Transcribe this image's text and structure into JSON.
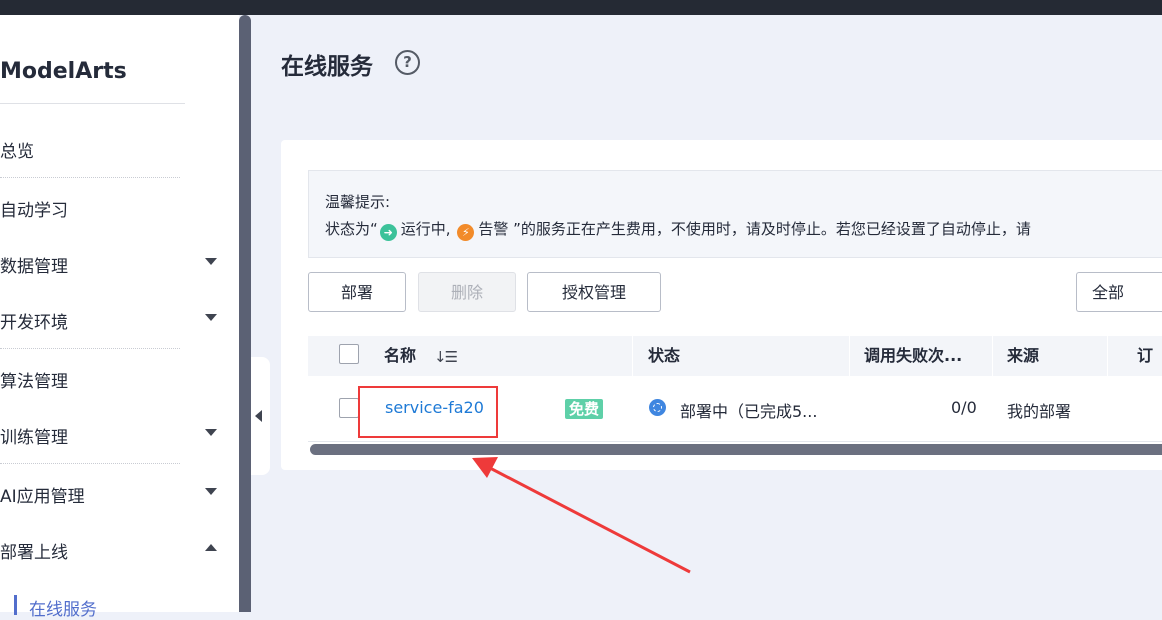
{
  "sidebar": {
    "brand": "ModelArts",
    "items": [
      {
        "label": "总览",
        "expandable": false
      },
      {
        "label": "自动学习",
        "expandable": false
      },
      {
        "label": "数据管理",
        "expandable": true,
        "expanded": false
      },
      {
        "label": "开发环境",
        "expandable": true,
        "expanded": false
      },
      {
        "label": "算法管理",
        "expandable": false
      },
      {
        "label": "训练管理",
        "expandable": true,
        "expanded": false
      },
      {
        "label": "AI应用管理",
        "expandable": true,
        "expanded": false
      },
      {
        "label": "部署上线",
        "expandable": true,
        "expanded": true
      }
    ],
    "sub_items": [
      {
        "label": "在线服务",
        "active": true
      }
    ]
  },
  "header": {
    "title": "在线服务",
    "help_icon": "question-circle-icon"
  },
  "notice": {
    "title": "温馨提示:",
    "prefix": "状态为“",
    "running_label": "运行中,",
    "alarm_label": "告警",
    "suffix": "”的服务正在产生费用，不使用时，请及时停止。若您已经设置了自动停止，请",
    "colors": {
      "running": "#3cc29a",
      "alarm": "#f28b2a"
    }
  },
  "toolbar": {
    "deploy_label": "部署",
    "delete_label": "删除",
    "auth_label": "授权管理",
    "filter_value": "全部"
  },
  "table": {
    "headers": {
      "name": "名称",
      "status": "状态",
      "fail_count": "调用失败次...",
      "source": "来源",
      "subscribe": "订阅"
    },
    "rows": [
      {
        "name": "service-fa20",
        "badge": "免费",
        "status": "部署中（已完成5...",
        "fail_count": "0/0",
        "source": "我的部署"
      }
    ]
  },
  "annotation": {
    "highlight_color": "#ee3a3a"
  }
}
